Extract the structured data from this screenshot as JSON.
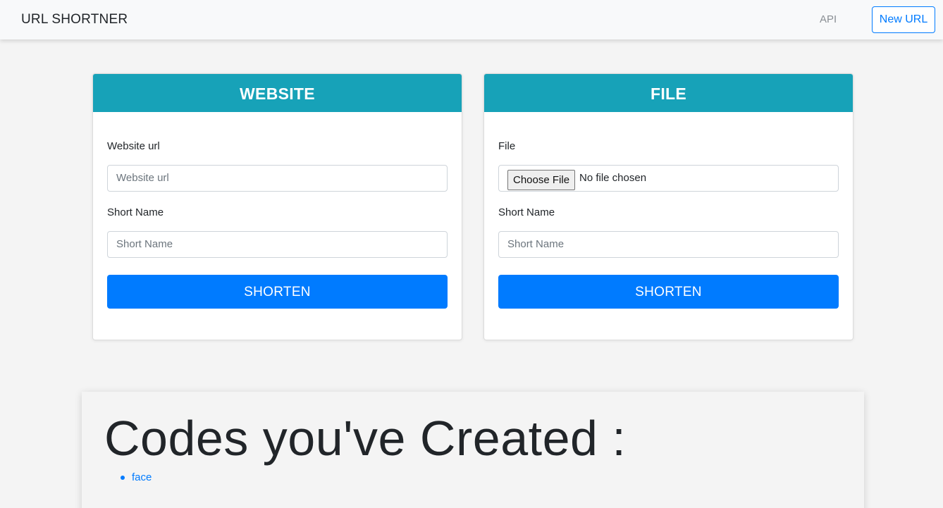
{
  "navbar": {
    "brand": "URL SHORTNER",
    "api_link": "API",
    "new_url_button": "New URL"
  },
  "website_card": {
    "title": "WEBSITE",
    "url_label": "Website url",
    "url_placeholder": "Website url",
    "short_name_label": "Short Name",
    "short_name_placeholder": "Short Name",
    "submit": "SHORTEN"
  },
  "file_card": {
    "title": "FILE",
    "file_label": "File",
    "choose_file": "Choose File",
    "no_file": "No file chosen",
    "short_name_label": "Short Name",
    "short_name_placeholder": "Short Name",
    "submit": "SHORTEN"
  },
  "codes": {
    "title": "Codes you've Created :",
    "items": [
      "face"
    ]
  },
  "colors": {
    "card_header": "#17a2b8",
    "primary": "#007bff",
    "background": "#f4f4f4"
  }
}
